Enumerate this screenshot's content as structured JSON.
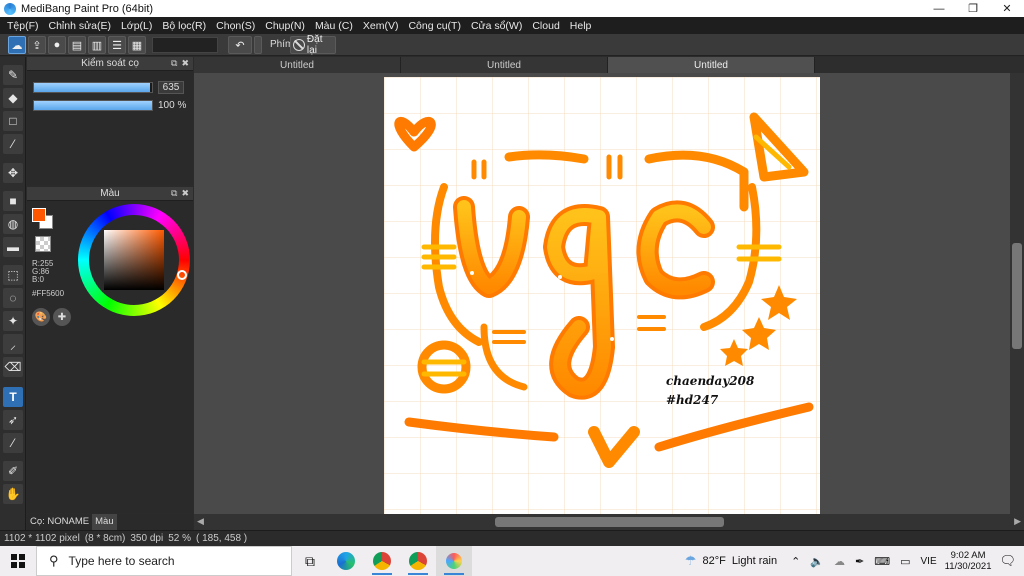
{
  "window": {
    "title": "MediBang Paint Pro (64bit)"
  },
  "menu": [
    "Tệp(F)",
    "Chỉnh sửa(E)",
    "Lớp(L)",
    "Bộ lọc(R)",
    "Chọn(S)",
    "Chụp(N)",
    "Màu (C)",
    "Xem(V)",
    "Công cụ(T)",
    "Cửa sổ(W)",
    "Cloud",
    "Help"
  ],
  "toolbar": {
    "key_label": "Phím",
    "reset_label": "Đặt lại"
  },
  "brush_panel": {
    "title": "Kiểm soát cọ",
    "size_value": "635",
    "opacity_value": "100 %",
    "opacity_fraction": 1.0,
    "size_fraction": 0.98
  },
  "color_panel": {
    "title": "Màu",
    "r": "R:255",
    "g": "G:86",
    "b": "B:0",
    "hex": "#FF5600",
    "fg_color": "#FF5600"
  },
  "panel_tabs": {
    "brush": "Cọ: NONAME",
    "color": "Màu"
  },
  "doc_tabs": [
    "Untitled",
    "Untitled",
    "Untitled"
  ],
  "artwork": {
    "word": "vgc",
    "credit_line1": "chaenday208",
    "credit_line2": "#hd247",
    "orange": "#FF8A00",
    "light_orange": "#FFB800",
    "grid": "#f5dcc0"
  },
  "status": {
    "size": "1102 * 1102 pixel",
    "cm": "(8 * 8cm)",
    "dpi": "350 dpi",
    "zoom": "52 %",
    "coords": "( 185, 458 )"
  },
  "taskbar": {
    "search_placeholder": "Type here to search",
    "weather_temp": "82°F",
    "weather_desc": "Light rain",
    "lang": "VIE",
    "time": "9:02 AM",
    "date": "11/30/2021"
  }
}
